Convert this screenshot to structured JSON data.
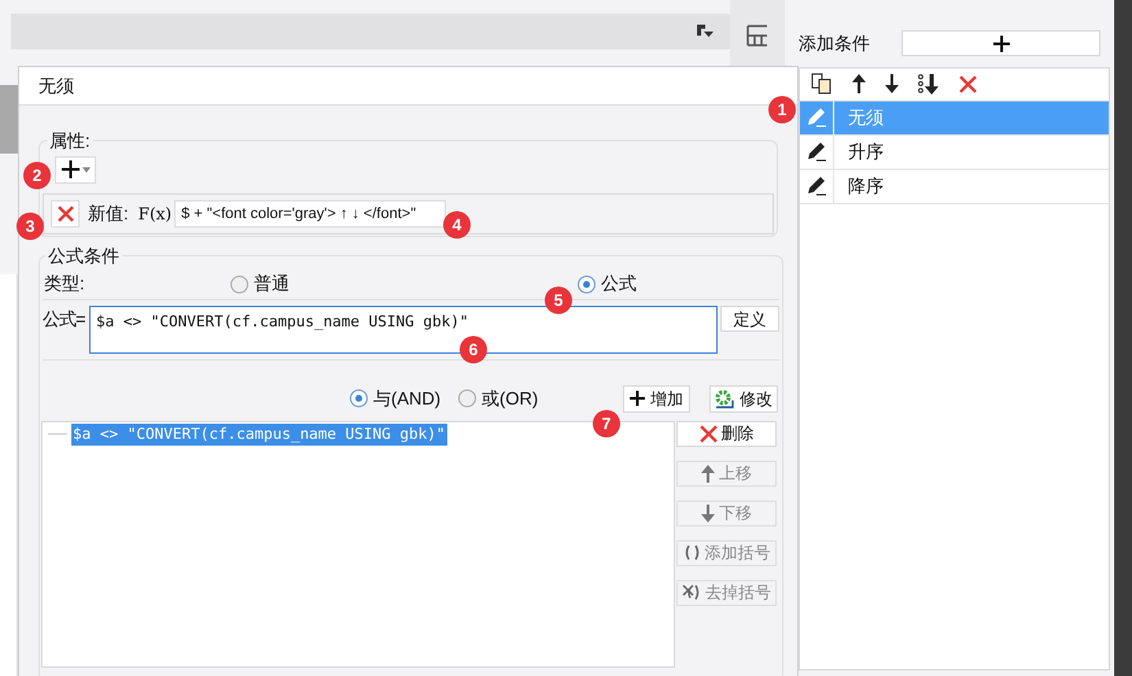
{
  "conditions_panel": {
    "add_label": "添加条件",
    "items": [
      {
        "name": "无须",
        "selected": true
      },
      {
        "name": "升序",
        "selected": false
      },
      {
        "name": "降序",
        "selected": false
      }
    ]
  },
  "dialog": {
    "title": "无须",
    "attributes": {
      "legend": "属性:",
      "rows": [
        {
          "label": "新值:",
          "formula_button": "F(x)",
          "value": "$ + \"<font color='gray'> ↑ ↓ </font>\""
        }
      ]
    },
    "formula_condition": {
      "legend": "公式条件",
      "type_label": "类型:",
      "types": [
        {
          "label": "普通",
          "selected": false
        },
        {
          "label": "公式",
          "selected": true
        }
      ],
      "formula_label": "公式=",
      "formula": "$a <> \"CONVERT(cf.campus_name USING gbk)\"",
      "define_button": "定义",
      "logic": [
        {
          "label": "与(AND)",
          "selected": true
        },
        {
          "label": "或(OR)",
          "selected": false
        }
      ],
      "add_button": "增加",
      "modify_button": "修改",
      "conditions": [
        {
          "text": "$a <> \"CONVERT(cf.campus_name USING gbk)\"",
          "selected": true
        }
      ],
      "side_buttons": [
        {
          "kind": "delete",
          "label": "删除",
          "disabled": false
        },
        {
          "kind": "up",
          "label": "上移",
          "disabled": true
        },
        {
          "kind": "down",
          "label": "下移",
          "disabled": true
        },
        {
          "kind": "add-brackets",
          "label": "添加括号",
          "disabled": true
        },
        {
          "kind": "remove-brackets",
          "label": "去掉括号",
          "disabled": true
        }
      ]
    }
  },
  "badges": [
    "1",
    "2",
    "3",
    "4",
    "5",
    "6",
    "7"
  ]
}
